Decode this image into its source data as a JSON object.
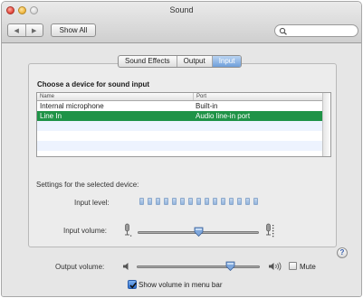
{
  "window": {
    "title": "Sound"
  },
  "toolbar": {
    "back_icon": "back-arrow-icon",
    "forward_icon": "forward-arrow-icon",
    "show_all_label": "Show All",
    "search_placeholder": "",
    "search_icon": "magnifier-icon"
  },
  "tabs": [
    {
      "label": "Sound Effects",
      "active": false
    },
    {
      "label": "Output",
      "active": false
    },
    {
      "label": "Input",
      "active": true
    }
  ],
  "input_panel": {
    "heading": "Choose a device for sound input",
    "columns": [
      "Name",
      "Port"
    ],
    "devices": [
      {
        "name": "Internal microphone",
        "port": "Built-in",
        "selected": false
      },
      {
        "name": "Line In",
        "port": "Audio line-in port",
        "selected": true
      }
    ],
    "settings_label": "Settings for the selected device:",
    "input_level_label": "Input level:",
    "input_level_segments": 15,
    "input_volume_label": "Input volume:",
    "input_volume_value": 0.5,
    "help_label": "?"
  },
  "output": {
    "volume_label": "Output volume:",
    "volume_value": 0.78,
    "mute_label": "Mute",
    "mute_checked": false,
    "show_in_menu_bar_label": "Show volume in menu bar",
    "show_in_menu_bar_checked": true
  },
  "colors": {
    "selection_green": "#1f9347",
    "tab_active_blue": "#6f9fda",
    "level_blue": "#93b4dc"
  }
}
